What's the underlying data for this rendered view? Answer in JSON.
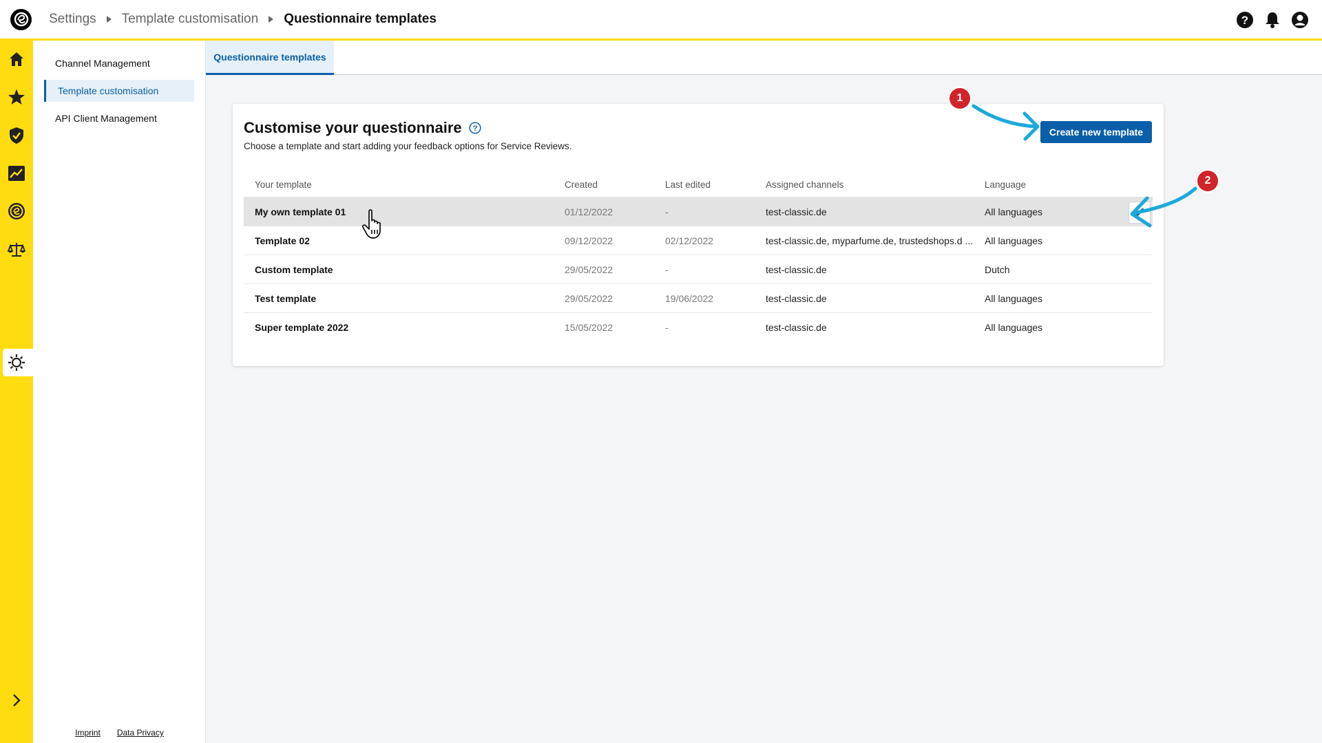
{
  "breadcrumb": {
    "items": [
      "Settings",
      "Template customisation"
    ],
    "current": "Questionnaire templates"
  },
  "subnav": {
    "items": [
      {
        "label": "Channel Management"
      },
      {
        "label": "Template customisation"
      },
      {
        "label": "API Client Management"
      }
    ],
    "footer": {
      "imprint": "Imprint",
      "privacy": "Data Privacy"
    }
  },
  "tabs": [
    {
      "label": "Questionnaire templates"
    }
  ],
  "card": {
    "title": "Customise your questionnaire",
    "subtitle": "Choose a template and start adding your feedback options for Service Reviews.",
    "create_button": "Create new template"
  },
  "table": {
    "headers": [
      "Your template",
      "Created",
      "Last edited",
      "Assigned channels",
      "Language"
    ],
    "rows": [
      [
        "My own template 01",
        "01/12/2022",
        "-",
        "test-classic.de",
        "All languages"
      ],
      [
        "Template 02",
        "09/12/2022",
        "02/12/2022",
        "test-classic.de, myparfume.de, trustedshops.d ...",
        "All languages"
      ],
      [
        "Custom template",
        "29/05/2022",
        "-",
        "test-classic.de",
        "Dutch"
      ],
      [
        "Test template",
        "29/05/2022",
        "19/06/2022",
        "test-classic.de",
        "All languages"
      ],
      [
        "Super template 2022",
        "15/05/2022",
        "-",
        "test-classic.de",
        "All languages"
      ]
    ]
  },
  "annotations": {
    "step1": "1",
    "step2": "2"
  },
  "colors": {
    "brand_yellow": "#ffdc0f",
    "accent_blue": "#0b5fa8",
    "annotation_red": "#d2232a",
    "annotation_arrow": "#1aa9dc"
  }
}
